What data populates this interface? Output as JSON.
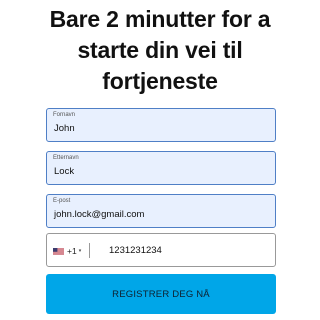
{
  "headline": {
    "line1": "Bare 2 minutter for a",
    "line2": "starte din vei til",
    "line3": "fortjeneste"
  },
  "form": {
    "first_name": {
      "label": "Fornavn",
      "value": "John"
    },
    "last_name": {
      "label": "Etternavn",
      "value": "Lock"
    },
    "email": {
      "label": "E-post",
      "value": "john.lock@gmail.com"
    },
    "phone": {
      "country_flag": "us-flag-icon",
      "dial_code": "+1",
      "caret": "▾",
      "value": "1231231234"
    },
    "submit_label": "REGISTRER DEG NÅ"
  },
  "colors": {
    "field_border": "#4f7fc6",
    "field_fill": "#e8f0fe",
    "button": "#00a6e8"
  }
}
